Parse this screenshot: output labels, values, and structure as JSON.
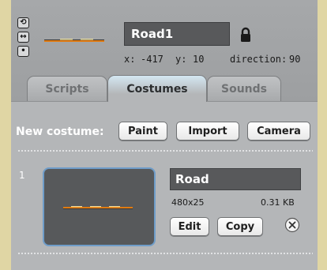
{
  "sprite": {
    "name": "Road1",
    "x_label": "x:",
    "x_value": "-417",
    "y_label": "y:",
    "y_value": "10",
    "direction_label": "direction:",
    "direction_value": "90",
    "rotation_buttons": [
      {
        "icon": "rotate-icon",
        "glyph": "⟲"
      },
      {
        "icon": "left-right-flip-icon",
        "glyph": "↔"
      },
      {
        "icon": "no-rotate-icon",
        "glyph": "•"
      }
    ],
    "lock_icon": "lock-icon"
  },
  "tabs": [
    {
      "label": "Scripts",
      "active": false
    },
    {
      "label": "Costumes",
      "active": true
    },
    {
      "label": "Sounds",
      "active": false
    }
  ],
  "new_costume": {
    "label": "New costume:",
    "buttons": [
      "Paint",
      "Import",
      "Camera"
    ]
  },
  "costumes": [
    {
      "index": "1",
      "name": "Road",
      "dimensions": "480x25",
      "size": "0.31 KB",
      "edit_label": "Edit",
      "copy_label": "Copy",
      "delete_icon": "close-icon"
    }
  ],
  "colors": {
    "accent_tab": "#d4e7f2",
    "thumb_border": "#6f9dc9",
    "road_orange": "#e07a10"
  }
}
